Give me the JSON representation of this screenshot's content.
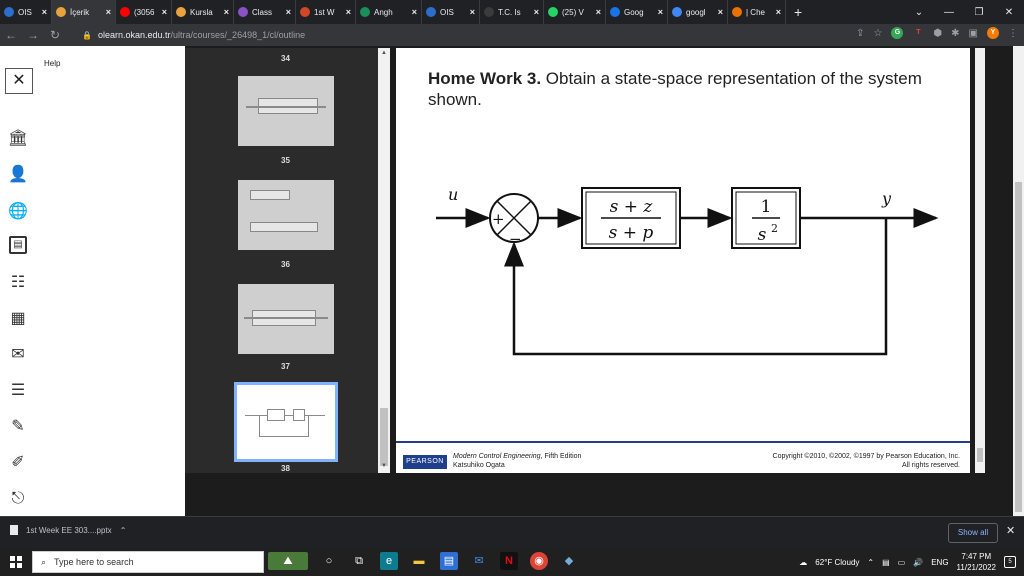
{
  "browser": {
    "tabs": [
      {
        "label": "OIS",
        "icon": "ois-icon",
        "color": "#2c6ecb"
      },
      {
        "label": "İçerik",
        "icon": "blackboard-icon",
        "color": "#e8a33c",
        "active": true
      },
      {
        "label": "(3056",
        "icon": "youtube-icon",
        "color": "#ff0000"
      },
      {
        "label": "Kursla",
        "icon": "blackboard-icon",
        "color": "#e8a33c"
      },
      {
        "label": "Class",
        "icon": "class-icon",
        "color": "#8a52c4"
      },
      {
        "label": "1st W",
        "icon": "ppt-icon",
        "color": "#d24726"
      },
      {
        "label": "Angh",
        "icon": "globe-icon",
        "color": "#1b8f5a"
      },
      {
        "label": "OIS",
        "icon": "ois-icon",
        "color": "#2c6ecb"
      },
      {
        "label": "T.C. Is",
        "icon": "gov-icon",
        "color": "#3b3b3b"
      },
      {
        "label": "(25) V",
        "icon": "whatsapp-icon",
        "color": "#25d366"
      },
      {
        "label": "Goog",
        "icon": "meet-icon",
        "color": "#1a73e8"
      },
      {
        "label": "googl",
        "icon": "google-icon",
        "color": "#4285f4"
      },
      {
        "label": "| Che",
        "icon": "chegg-icon",
        "color": "#eb7100"
      }
    ],
    "url_host": "olearn.okan.edu.tr",
    "url_path": "/ultra/courses/_26498_1/cl/outline",
    "profile_initial": "Y"
  },
  "help_label": "Help",
  "thumbnails": [
    {
      "number": "34"
    },
    {
      "number": "35"
    },
    {
      "number": "36"
    },
    {
      "number": "37",
      "selected": true
    },
    {
      "number": "38"
    }
  ],
  "slide": {
    "title_bold": "Home Work 3.",
    "title_rest": " Obtain a state-space representation of the system shown.",
    "diagram": {
      "input": "u",
      "output": "y",
      "sum_plus": "+",
      "sum_minus": "−",
      "block1_num": "s + z",
      "block1_den": "s + p",
      "block2_num": "1",
      "block2_den": "s",
      "block2_den_exp": "2"
    },
    "publisher": "PEARSON",
    "book_title": "Modern Control Engineering",
    "book_edition": ", Fifth Edition",
    "book_author": "Katsuhiko Ogata",
    "copyright_line1": "Copyright ©2010, ©2002, ©1997 by Pearson Education, Inc.",
    "copyright_line2": "All rights reserved.",
    "accent_color": "#1f3e8c"
  },
  "download_shelf": {
    "file_name": "1st Week EE 303....pptx",
    "show_all": "Show all"
  },
  "taskbar": {
    "search_placeholder": "Type here to search",
    "weather": "62°F  Cloudy",
    "language": "ENG",
    "time": "7:47 PM",
    "date": "11/21/2022",
    "notification_count": "5"
  }
}
